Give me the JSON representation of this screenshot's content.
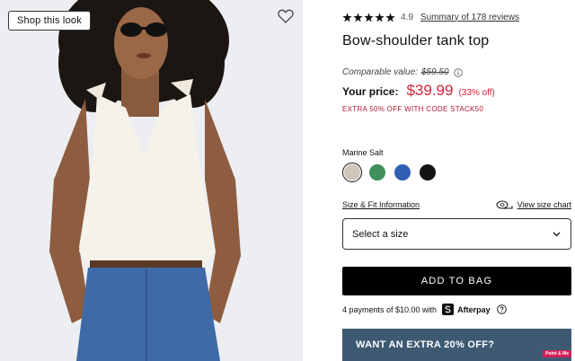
{
  "image_panel": {
    "shop_look_label": "Shop this look"
  },
  "product": {
    "rating_value": "4.9",
    "stars": 5,
    "reviews_link": "Summary of 178 reviews",
    "title": "Bow-shoulder tank top",
    "comparable_label": "Comparable value:",
    "comparable_price": "$59.50",
    "price_label": "Your price:",
    "price": "$39.99",
    "discount": "(33% off)",
    "promo": "EXTRA 50% OFF WITH CODE STACK50"
  },
  "color": {
    "selected_name": "Marine Salt",
    "swatches": [
      {
        "name": "marine-salt",
        "color": "#cfc6bb",
        "selected": true
      },
      {
        "name": "green",
        "color": "#3e8f5b",
        "selected": false
      },
      {
        "name": "blue",
        "color": "#2f5fb3",
        "selected": false
      },
      {
        "name": "black",
        "color": "#141414",
        "selected": false
      }
    ]
  },
  "size": {
    "fit_info_link": "Size & Fit Information",
    "size_chart_link": "View size chart",
    "select_placeholder": "Select a size"
  },
  "actions": {
    "add_to_bag": "ADD TO BAG"
  },
  "afterpay": {
    "text": "4 payments of $10.00 with",
    "brand": "Afterpay"
  },
  "banner": {
    "text": "WANT AN EXTRA 20% OFF?",
    "badge": "Point & Me"
  },
  "colors": {
    "sale_red": "#d0243a",
    "banner_blue": "#3e5a73"
  }
}
